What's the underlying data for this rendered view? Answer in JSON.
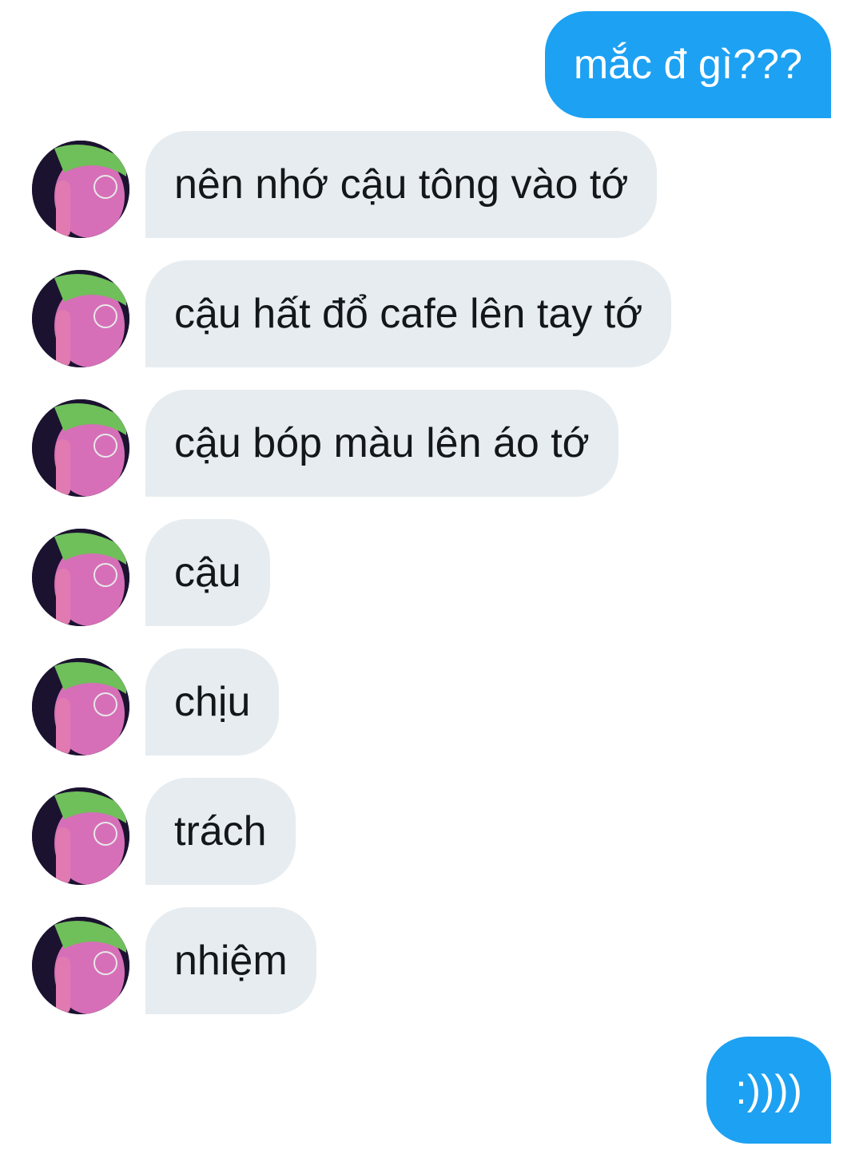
{
  "conversation": {
    "messages": [
      {
        "from": "me",
        "text": "mắc đ gì???"
      },
      {
        "from": "them",
        "text": "nên nhớ cậu tông vào tớ",
        "avatar": "user-avatar"
      },
      {
        "from": "them",
        "text": "cậu hất đổ cafe lên tay tớ",
        "avatar": "user-avatar"
      },
      {
        "from": "them",
        "text": "cậu bóp màu lên áo tớ",
        "avatar": "user-avatar"
      },
      {
        "from": "them",
        "text": "cậu",
        "avatar": "user-avatar"
      },
      {
        "from": "them",
        "text": "chịu",
        "avatar": "user-avatar"
      },
      {
        "from": "them",
        "text": "trách",
        "avatar": "user-avatar"
      },
      {
        "from": "them",
        "text": "nhiệm",
        "avatar": "user-avatar"
      },
      {
        "from": "me",
        "text": ":))))"
      }
    ]
  },
  "colors": {
    "outgoing_bubble": "#1da1f2",
    "incoming_bubble": "#e6ecf0",
    "incoming_text": "#14171a",
    "outgoing_text": "#ffffff"
  }
}
